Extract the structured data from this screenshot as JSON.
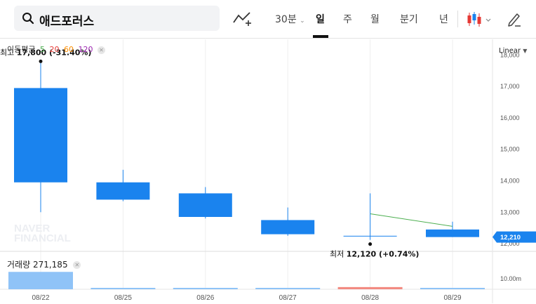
{
  "search": {
    "title": "애드포러스"
  },
  "timeframes": [
    {
      "label": "30분",
      "has_dropdown": true,
      "active": false
    },
    {
      "label": "일",
      "has_dropdown": false,
      "active": true
    },
    {
      "label": "주",
      "has_dropdown": false,
      "active": false
    },
    {
      "label": "월",
      "has_dropdown": false,
      "active": false
    },
    {
      "label": "분기",
      "has_dropdown": false,
      "active": false
    },
    {
      "label": "년",
      "has_dropdown": false,
      "active": false
    }
  ],
  "toolbar": {
    "chart_type_icon": "chart-line-add-icon",
    "candle_icon": "candlestick-icon",
    "draw_icon": "pencil-icon",
    "scale_label": "Linear"
  },
  "ma_legend": {
    "label": "이동평균",
    "periods": [
      {
        "value": "5",
        "color": "#4caf50"
      },
      {
        "value": "20",
        "color": "#e53935"
      },
      {
        "value": "60",
        "color": "#fb8c00"
      },
      {
        "value": "120",
        "color": "#9c27b0"
      }
    ]
  },
  "volume_legend": {
    "label": "거래량",
    "value": "271,185"
  },
  "watermark": {
    "line1": "NAVER",
    "line2": "FINANCIAL"
  },
  "annotations": {
    "high": {
      "prefix": "최고",
      "value": "17,800",
      "change": "(-31.40%)"
    },
    "low": {
      "prefix": "최저",
      "value": "12,120",
      "change": "(+0.74%)"
    }
  },
  "price_axis": {
    "ticks": [
      "18,000",
      "17,000",
      "16,000",
      "15,000",
      "14,000",
      "13,000",
      "12,000"
    ],
    "last_price": "12,210"
  },
  "volume_axis": {
    "label": "10.00m"
  },
  "colors": {
    "down": "#1a83ee",
    "up": "#ef5350",
    "ma": "#4caf50",
    "grid": "#efefef"
  },
  "chart_data": {
    "type": "candlestick",
    "categories": [
      "08/22",
      "08/25",
      "08/26",
      "08/27",
      "08/28",
      "08/29"
    ],
    "candles": [
      {
        "date": "08/22",
        "open": 16950,
        "high": 17800,
        "low": 13000,
        "close": 13950,
        "direction": "down"
      },
      {
        "date": "08/25",
        "open": 13950,
        "high": 14350,
        "low": 13350,
        "close": 13400,
        "direction": "down"
      },
      {
        "date": "08/26",
        "open": 13600,
        "high": 13800,
        "low": 12800,
        "close": 12850,
        "direction": "down"
      },
      {
        "date": "08/27",
        "open": 12750,
        "high": 13150,
        "low": 12250,
        "close": 12300,
        "direction": "down"
      },
      {
        "date": "08/28",
        "open": 12250,
        "high": 13600,
        "low": 12120,
        "close": 12250,
        "direction": "down"
      },
      {
        "date": "08/29",
        "open": 12450,
        "high": 12700,
        "low": 12210,
        "close": 12210,
        "direction": "down"
      }
    ],
    "moving_average_5": [
      {
        "date": "08/28",
        "value": 12950
      },
      {
        "date": "08/29",
        "value": 12550
      }
    ],
    "volume": [
      {
        "date": "08/22",
        "direction": "down",
        "value": 7500000
      },
      {
        "date": "08/25",
        "direction": "down",
        "value": 400000
      },
      {
        "date": "08/26",
        "direction": "down",
        "value": 250000
      },
      {
        "date": "08/27",
        "direction": "down",
        "value": 250000
      },
      {
        "date": "08/28",
        "direction": "up",
        "value": 950000
      },
      {
        "date": "08/29",
        "direction": "down",
        "value": 271185
      }
    ],
    "ylim": [
      11800,
      18500
    ],
    "yticks": [
      18000,
      17000,
      16000,
      15000,
      14000,
      13000,
      12000
    ],
    "grid": true
  }
}
